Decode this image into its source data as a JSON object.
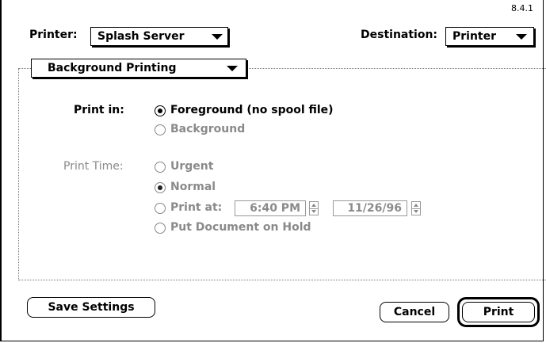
{
  "version": "8.4.1",
  "printer": {
    "label": "Printer:",
    "value": "Splash Server"
  },
  "destination": {
    "label": "Destination:",
    "value": "Printer"
  },
  "panel": {
    "value": "Background Printing"
  },
  "print_in": {
    "label": "Print in:",
    "options": [
      "Foreground (no spool file)",
      "Background"
    ],
    "selected": "Foreground (no spool file)"
  },
  "print_time": {
    "label": "Print Time:",
    "urgent": "Urgent",
    "normal": "Normal",
    "print_at": "Print at:",
    "time": "6:40 PM",
    "date": "11/26/96",
    "hold": "Put Document on Hold",
    "selected": "Normal"
  },
  "buttons": {
    "save": "Save Settings",
    "cancel": "Cancel",
    "print": "Print"
  }
}
